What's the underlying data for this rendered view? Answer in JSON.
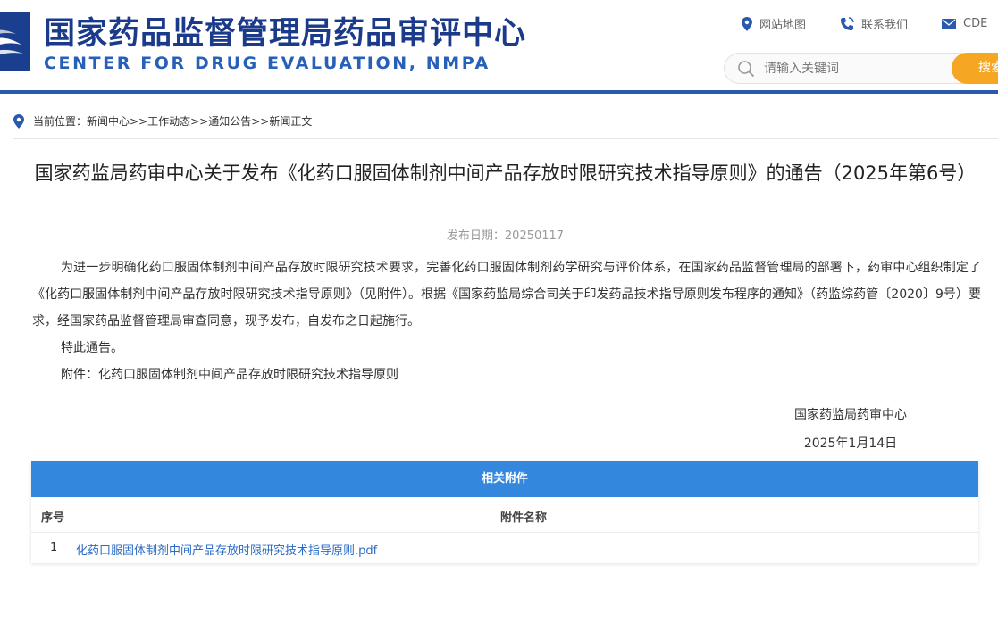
{
  "header": {
    "title_cn": "国家药品监督管理局药品审评中心",
    "title_en": "CENTER FOR DRUG EVALUATION, NMPA",
    "links": [
      {
        "label": "网站地图",
        "icon": "location-pin-icon"
      },
      {
        "label": "联系我们",
        "icon": "phone-icon"
      },
      {
        "label": "CDE",
        "icon": "mail-icon"
      }
    ],
    "search": {
      "placeholder": "请输入关键词",
      "button_label": "搜索"
    }
  },
  "breadcrumb": "当前位置：新闻中心>>工作动态>>通知公告>>新闻正文",
  "article": {
    "title": "国家药监局药审中心关于发布《化药口服固体制剂中间产品存放时限研究技术指导原则》的通告（2025年第6号）",
    "pub_date": "发布日期：20250117",
    "paragraphs": [
      "为进一步明确化药口服固体制剂中间产品存放时限研究技术要求，完善化药口服固体制剂药学研究与评价体系，在国家药品监督管理局的部署下，药审中心组织制定了《化药口服固体制剂中间产品存放时限研究技术指导原则》（见附件）。根据《国家药监局综合司关于印发药品技术指导原则发布程序的通知》（药监综药管〔2020〕9号）要求，经国家药品监督管理局审查同意，现予发布，自发布之日起施行。",
      "特此通告。",
      "附件：化药口服固体制剂中间产品存放时限研究技术指导原则"
    ],
    "signature_org": "国家药监局药审中心",
    "signature_date": "2025年1月14日"
  },
  "attachments": {
    "heading": "相关附件",
    "col_index": "序号",
    "col_name": "附件名称",
    "rows": [
      {
        "index": "1",
        "name": "化药口服固体制剂中间产品存放时限研究技术指导原则.pdf"
      }
    ]
  },
  "colors": {
    "brand_blue": "#1b3a8a",
    "accent_orange": "#f5a623",
    "table_header": "#3388de",
    "link": "#2b6cc4"
  }
}
